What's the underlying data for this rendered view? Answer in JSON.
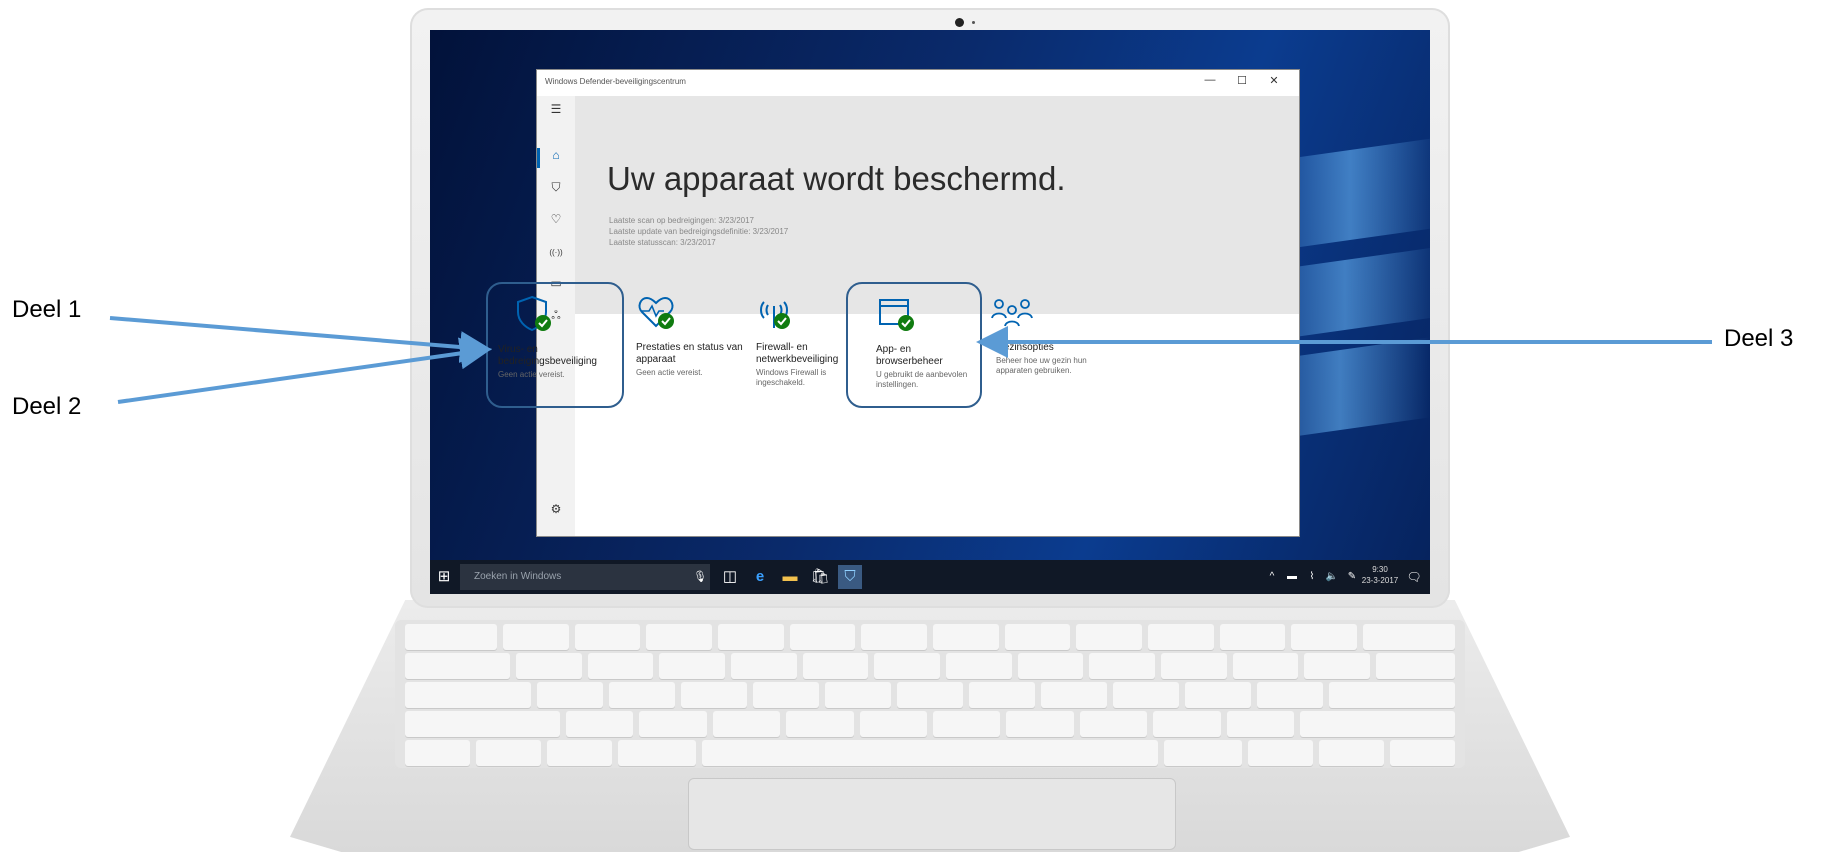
{
  "window": {
    "title": "Windows Defender-beveiligingscentrum",
    "minimize_icon": "—",
    "maximize_icon": "☐",
    "close_icon": "✕"
  },
  "sidebar": {
    "items": [
      {
        "name": "menu",
        "glyph": "☰"
      },
      {
        "name": "home",
        "glyph": "⌂"
      },
      {
        "name": "virus-protection",
        "glyph": "⛉"
      },
      {
        "name": "health",
        "glyph": "♡"
      },
      {
        "name": "firewall",
        "glyph": "((·))"
      },
      {
        "name": "app-browser",
        "glyph": "▭"
      },
      {
        "name": "family",
        "glyph": "ஃ"
      }
    ],
    "settings_glyph": "⚙"
  },
  "hero": {
    "title": "Uw apparaat wordt beschermd.",
    "lines": [
      "Laatste scan op bedreigingen: 3/23/2017",
      "Laatste update van bedreigingsdefinitie: 3/23/2017",
      "Laatste statusscan: 3/23/2017"
    ]
  },
  "tiles": [
    {
      "label": "Virus- en bedreigingsbeveiliging",
      "sub": "Geen actie vereist.",
      "icon": "shield-check-icon"
    },
    {
      "label": "Prestaties en status van apparaat",
      "sub": "Geen actie vereist.",
      "icon": "heart-check-icon"
    },
    {
      "label": "Firewall- en netwerkbeveiliging",
      "sub": "Windows Firewall is ingeschakeld.",
      "icon": "antenna-check-icon"
    },
    {
      "label": "App- en browserbeheer",
      "sub": "U gebruikt de aanbevolen instellingen.",
      "icon": "browser-check-icon"
    },
    {
      "label": "Gezinsopties",
      "sub": "Beheer hoe uw gezin hun apparaten gebruiken.",
      "icon": "family-icon"
    }
  ],
  "taskbar": {
    "search_placeholder": "Zoeken in Windows",
    "time": "9:30",
    "date": "23-3-2017"
  },
  "callouts": {
    "deel1": "Deel 1",
    "deel2": "Deel 2",
    "deel3": "Deel 3"
  },
  "colors": {
    "accent": "#0063b1",
    "check_green": "#107c10",
    "arrow": "#5b9bd5",
    "highlight_border": "#2f5e8e"
  }
}
